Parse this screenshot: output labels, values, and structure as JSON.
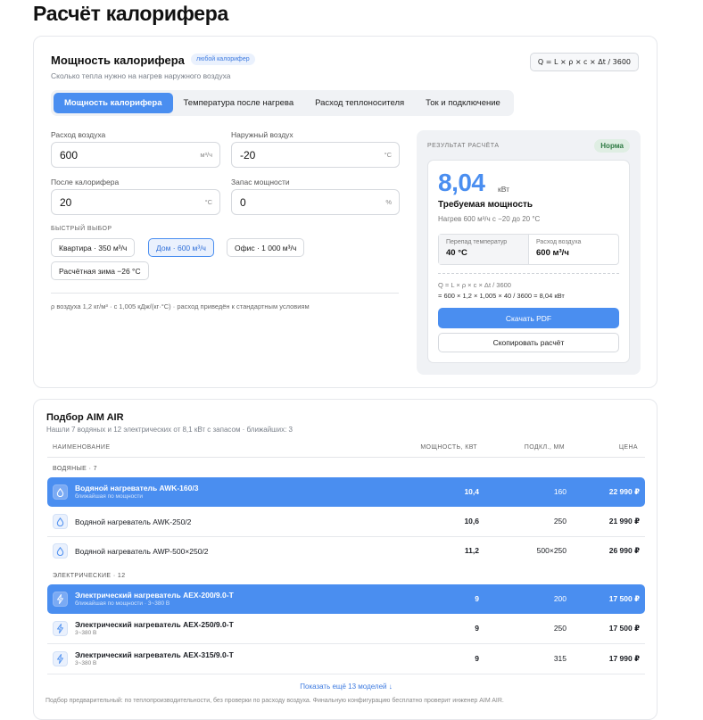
{
  "page_title": "Расчёт калорифера",
  "calc": {
    "title": "Мощность калорифера",
    "badge": "любой калорифер",
    "subtitle": "Сколько тепла нужно на нагрев наружного воздуха",
    "formula": "Q = L × ρ × c × Δt / 3600",
    "tabs": [
      {
        "label": "Мощность калорифера",
        "active": true
      },
      {
        "label": "Температура после нагрева"
      },
      {
        "label": "Расход теплоносителя"
      },
      {
        "label": "Ток и подключение"
      }
    ],
    "fields": {
      "air_flow": {
        "label": "Расход воздуха",
        "value": "600",
        "unit": "м³/ч"
      },
      "outdoor": {
        "label": "Наружный воздух",
        "value": "-20",
        "unit": "°C"
      },
      "after": {
        "label": "После калорифера",
        "value": "20",
        "unit": "°C"
      },
      "reserve": {
        "label": "Запас мощности",
        "value": "0",
        "unit": "%"
      }
    },
    "quick_label": "БЫСТРЫЙ ВЫБОР",
    "quick": [
      "Квартира · 350 м³/ч",
      "Дом · 600 м³/ч",
      "Офис · 1 000 м³/ч",
      "Расчётная зима −26 °C"
    ],
    "note": "ρ воздуха 1,2 кг/м³ · c 1,005 кДж/(кг·°C) · расход приведён к стандартным условиям"
  },
  "result": {
    "label": "РЕЗУЛЬТАТ РАСЧЁТА",
    "status": "Норма",
    "value": "8,04",
    "unit": "кВт",
    "caption": "Требуемая мощность",
    "caption_sub": "Нагрев 600 м³/ч с −20 до 20 °C",
    "delta_label": "Перепад температур",
    "delta_value": "40 °C",
    "flow_label": "Расход воздуха",
    "flow_value": "600 м³/ч",
    "formula": "Q = L × ρ × c × Δt / 3600",
    "formula_calc": "= 600 × 1,2 × 1,005 × 40 / 3600 = 8,04 кВт",
    "pdf_button": "Скачать PDF",
    "copy_button": "Скопировать расчёт"
  },
  "pick": {
    "title": "Подбор AIM AIR",
    "subtitle": "Нашли 7 водяных и 12 электрических от 8,1 кВт с запасом · ближайших: 3",
    "headers": {
      "name": "НАИМЕНОВАНИЕ",
      "power": "МОЩНОСТЬ, КВТ",
      "size": "ПОДКЛ., ММ",
      "price": "ЦЕНА"
    },
    "water_group": "ВОДЯНЫЕ · 7",
    "electric_group": "ЭЛЕКТРИЧЕСКИЕ · 12",
    "water": [
      {
        "name": "Водяной нагреватель AWK-160/3",
        "sub": "ближайшая по мощности",
        "power": "10,4",
        "size": "160",
        "price": "22 990 ₽"
      },
      {
        "name": "Водяной нагреватель AWK-250/2",
        "sub": "",
        "power": "10,6",
        "size": "250",
        "price": "21 990 ₽"
      },
      {
        "name": "Водяной нагреватель AWP-500×250/2",
        "sub": "",
        "power": "11,2",
        "size": "500×250",
        "price": "26 990 ₽"
      }
    ],
    "electric": [
      {
        "name": "Электрический нагреватель AEX-200/9.0-T",
        "sub": "ближайшая по мощности · 3~380 В",
        "power": "9",
        "size": "200",
        "price": "17 500 ₽"
      },
      {
        "name": "Электрический нагреватель AEX-250/9.0-T",
        "sub": "3~380 В",
        "power": "9",
        "size": "250",
        "price": "17 500 ₽"
      },
      {
        "name": "Электрический нагреватель AEX-315/9.0-T",
        "sub": "3~380 В",
        "power": "9",
        "size": "315",
        "price": "17 990 ₽"
      }
    ],
    "more": "Показать ещё 13 моделей ↓",
    "footer": "Подбор предварительный: по теплопроизводительности, без проверки по расходу воздуха. Финальную конфигурацию бесплатно проверит инженер AIM AIR."
  },
  "colors": {
    "accent": "#4a8ef0",
    "ok": "#2e7a43"
  },
  "icons": {
    "water": "droplet-icon",
    "electric": "bolt-icon"
  }
}
